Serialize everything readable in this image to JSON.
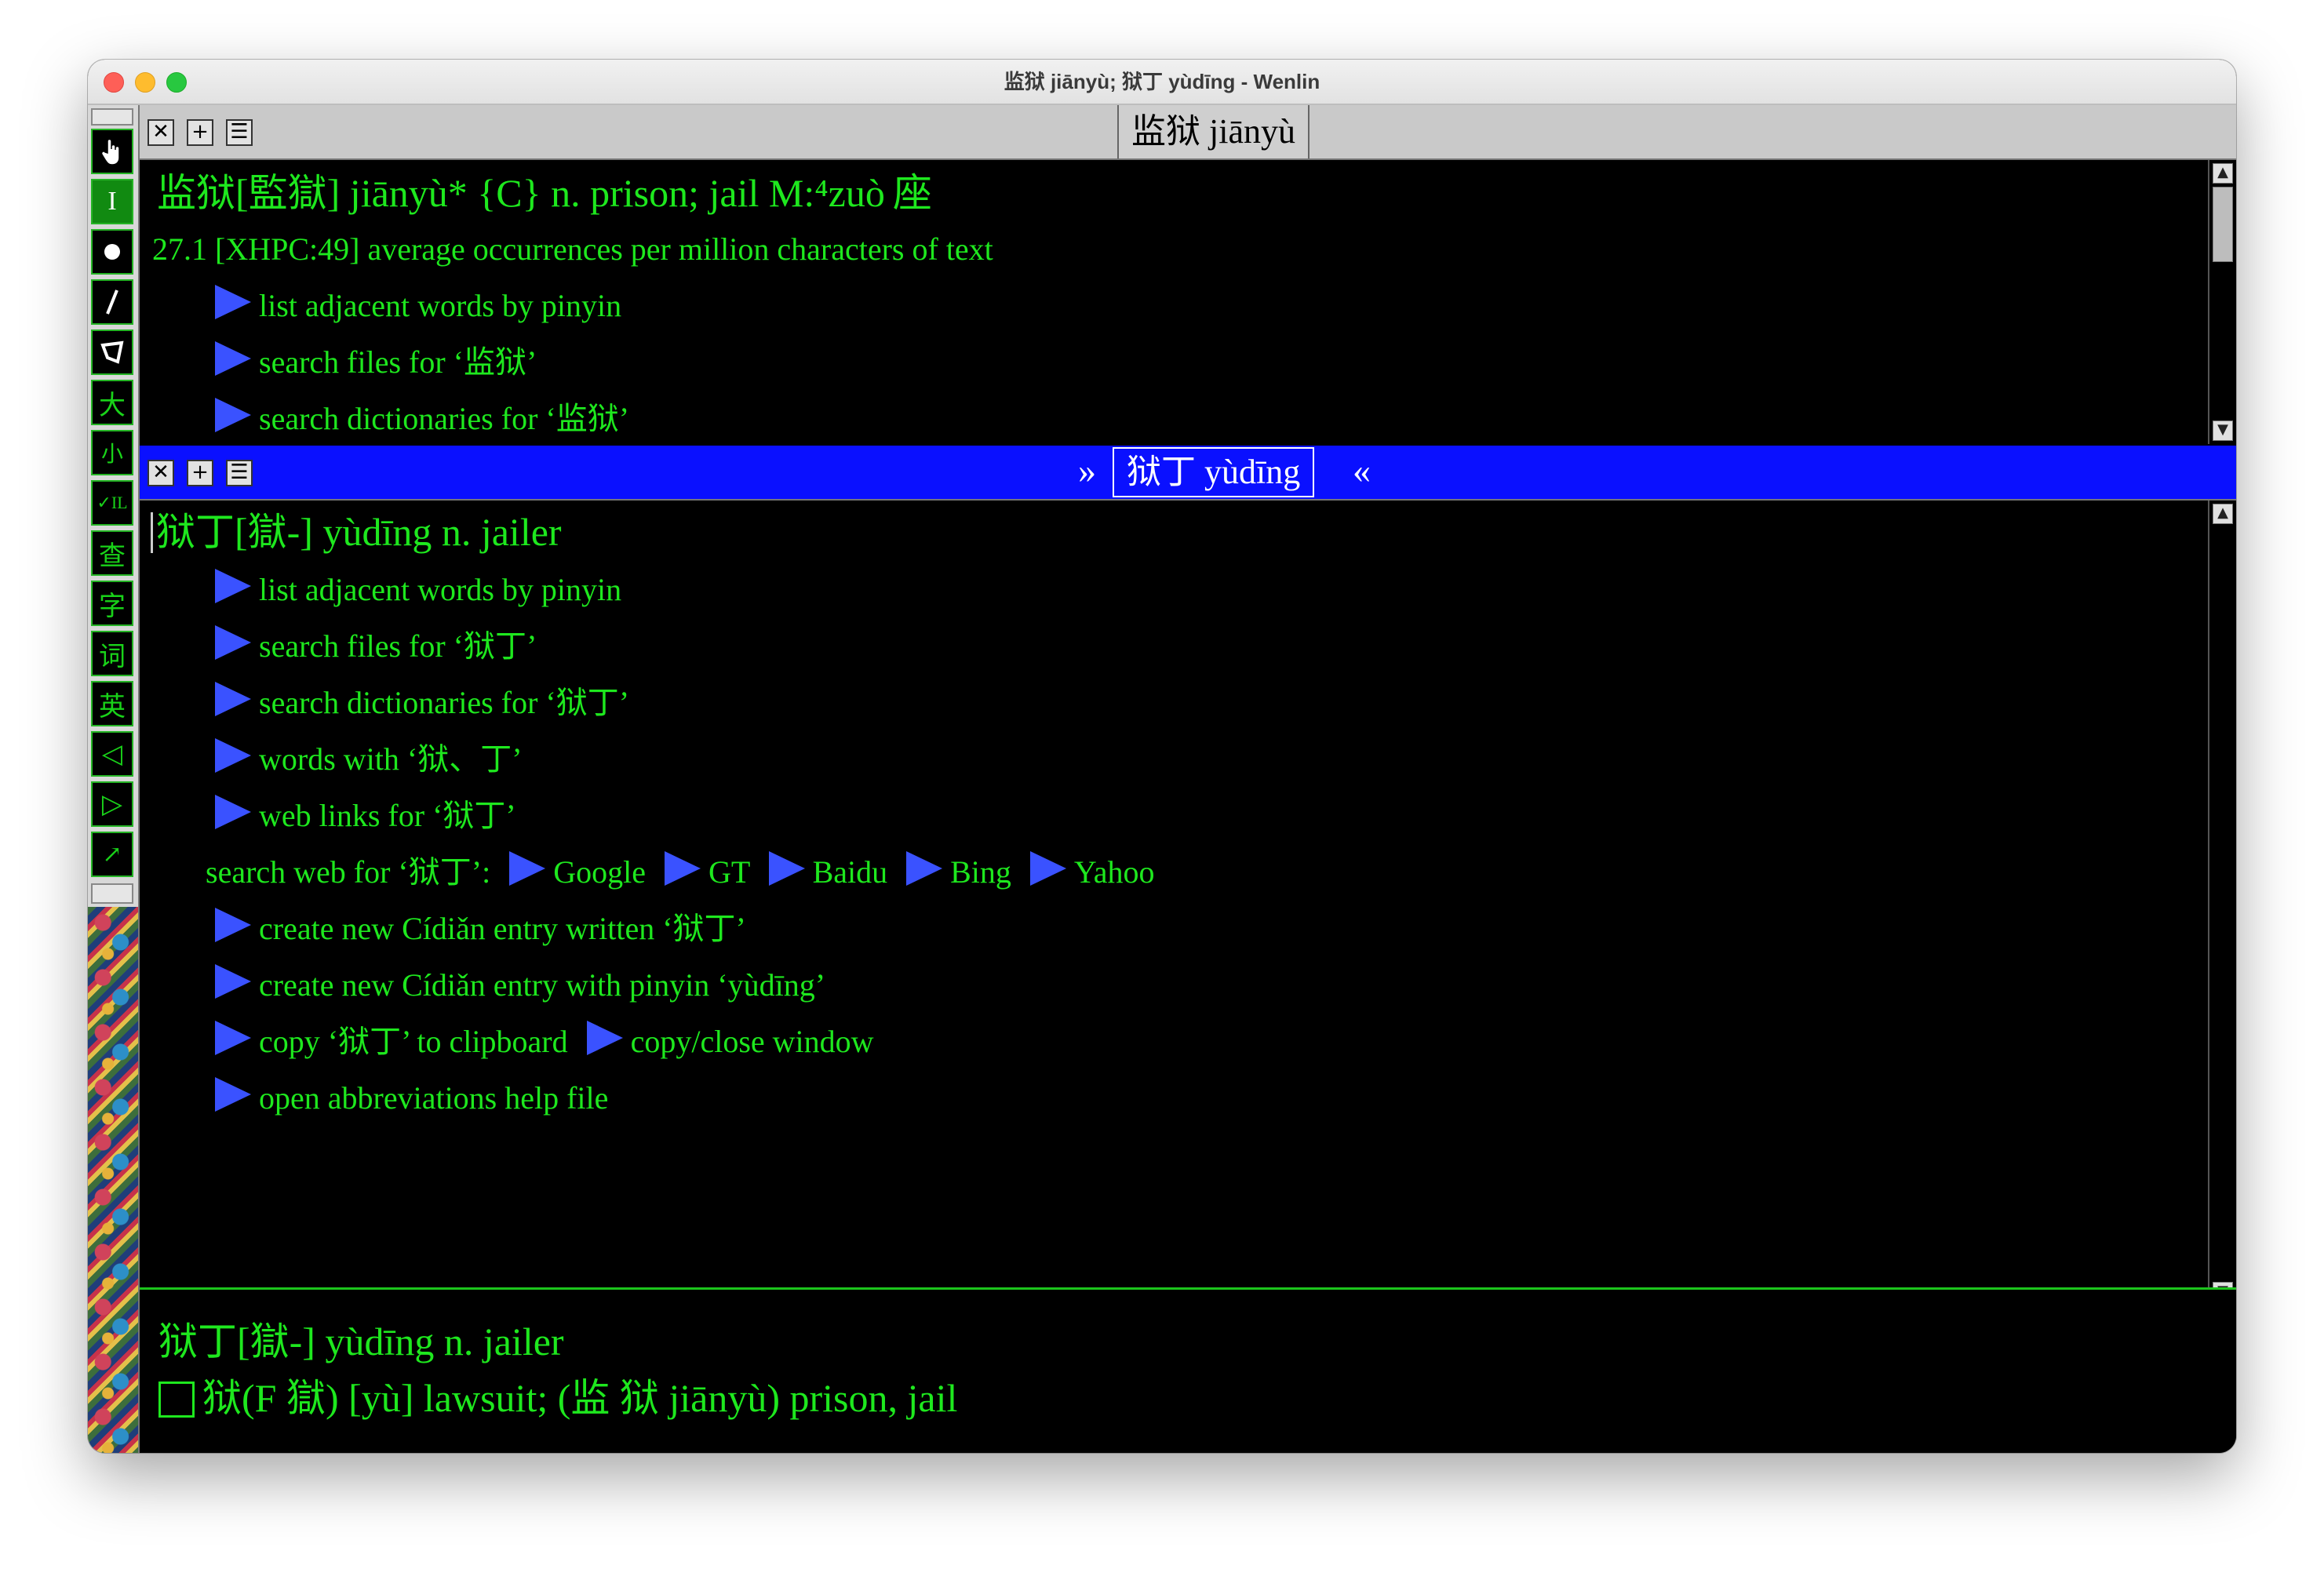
{
  "window": {
    "title": "监狱 jiānyù; 狱丁 yùdīng - Wenlin"
  },
  "toolbar": {
    "items": [
      {
        "icon": "hand-pointer-icon"
      },
      {
        "icon": "text-cursor-icon",
        "label": "I"
      },
      {
        "icon": "circle-dot-icon"
      },
      {
        "icon": "pencil-icon"
      },
      {
        "icon": "eraser-icon"
      },
      {
        "icon": "text-larger-icon",
        "label": "大"
      },
      {
        "icon": "text-smaller-icon",
        "label": "小"
      },
      {
        "icon": "checkmark-icon",
        "label": "✓IL"
      },
      {
        "icon": "lookup-icon",
        "label": "查"
      },
      {
        "icon": "character-icon",
        "label": "字"
      },
      {
        "icon": "word-icon",
        "label": "词"
      },
      {
        "icon": "english-icon",
        "label": "英"
      },
      {
        "icon": "back-arrow-icon",
        "label": "◁"
      },
      {
        "icon": "forward-arrow-icon",
        "label": "▷"
      },
      {
        "icon": "expand-icon",
        "label": "↗"
      }
    ]
  },
  "pane1": {
    "tab": "监狱 jiānyù",
    "entry_head": "监狱[監獄] jiānyù* {C} n. prison; jail M:⁴zuò",
    "entry_measure": "座",
    "frequency": "27.1 [XHPC:49] average occurrences per million characters of text",
    "links": [
      "list adjacent words by pinyin",
      "search files for ‘监狱’",
      "search dictionaries for ‘监狱’"
    ]
  },
  "pane2": {
    "tab": "狱丁 yùdīng",
    "chev_left": "»",
    "chev_right": "«",
    "entry_head": "狱丁[獄-] yùdīng n. jailer",
    "links": [
      "list adjacent words by pinyin",
      "search files for ‘狱丁’",
      "search dictionaries for ‘狱丁’",
      "words with ‘狱、丁’",
      "web links for ‘狱丁’"
    ],
    "search_web_label": "search web for ‘狱丁’:",
    "search_engines": [
      "Google",
      "GT",
      "Baidu",
      "Bing",
      "Yahoo"
    ],
    "links2": [
      "create new Cídiǎn entry written ‘狱丁’",
      "create new Cídiǎn entry with pinyin ‘yùdīng’"
    ],
    "copy_label": "copy ‘狱丁’ to clipboard",
    "copy_close_label": "copy/close window",
    "abbrev_label": "open abbreviations help file"
  },
  "bottom": {
    "line1": "狱丁[獄-] yùdīng n. jailer",
    "line2": "狱(F 獄) [yù] lawsuit; (监 狱 jiānyù) prison, jail"
  },
  "colors": {
    "text_green": "#1ee81e",
    "link_arrow": "#3a52ff",
    "active_bar": "#0a10ff"
  }
}
